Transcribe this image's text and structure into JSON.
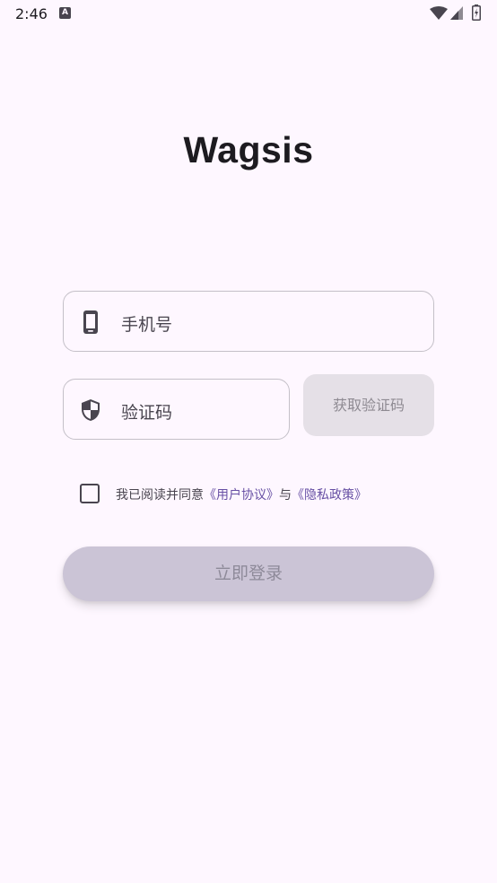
{
  "status_bar": {
    "time": "2:46",
    "notification_glyph": "A"
  },
  "app": {
    "title": "Wagsis"
  },
  "phone_field": {
    "placeholder": "手机号",
    "icon": "smartphone-icon"
  },
  "code_field": {
    "placeholder": "验证码",
    "icon": "shield-icon"
  },
  "get_code_button": {
    "label": "获取验证码"
  },
  "agreement": {
    "checked": false,
    "prefix": "我已阅读并同意",
    "user_agreement": "《用户协议》",
    "conjunction": "与",
    "privacy_policy": "《隐私政策》"
  },
  "login_button": {
    "label": "立即登录"
  },
  "colors": {
    "background": "#FEF7FF",
    "accent": "#6750A4",
    "disabled_button": "#CBC4D6",
    "outline": "#C4C0C8"
  }
}
